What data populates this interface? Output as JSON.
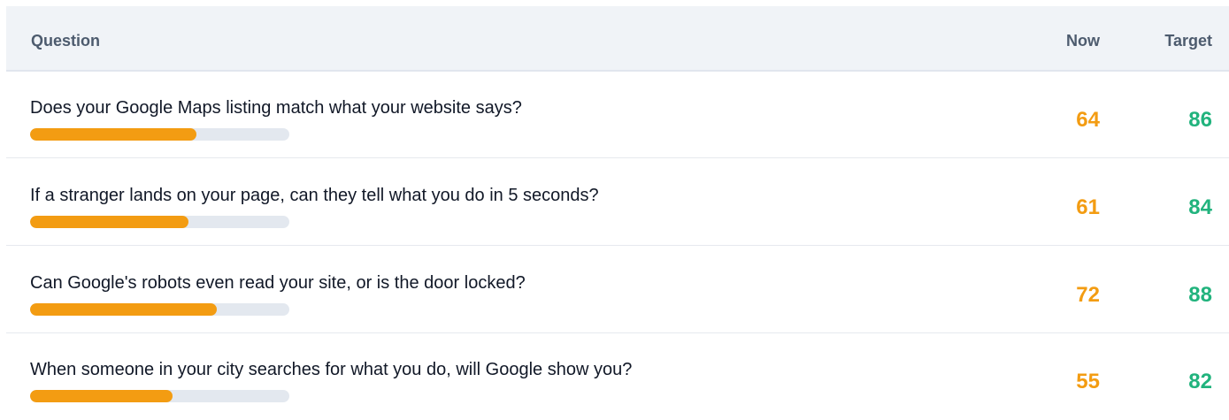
{
  "header": {
    "question_label": "Question",
    "now_label": "Now",
    "target_label": "Target"
  },
  "colors": {
    "now": "#f39c12",
    "target": "#21b37d",
    "track": "#e3e8ef"
  },
  "rows": [
    {
      "question": "Does your Google Maps listing match what your website says?",
      "now": "64",
      "target": "86",
      "progress": 0.64
    },
    {
      "question": "If a stranger lands on your page, can they tell what you do in 5 seconds?",
      "now": "61",
      "target": "84",
      "progress": 0.61
    },
    {
      "question": "Can Google's robots even read your site, or is the door locked?",
      "now": "72",
      "target": "88",
      "progress": 0.72
    },
    {
      "question": "When someone in your city searches for what you do, will Google show you?",
      "now": "55",
      "target": "82",
      "progress": 0.55
    }
  ]
}
